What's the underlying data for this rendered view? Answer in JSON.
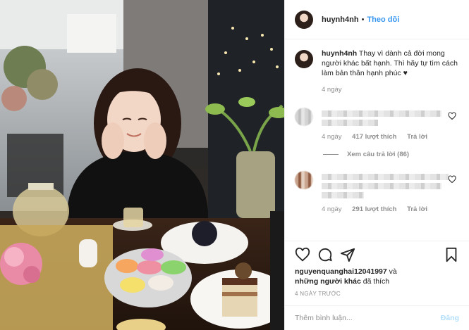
{
  "header": {
    "username": "huynh4nh",
    "separator": "•",
    "follow_label": "Theo dõi"
  },
  "caption": {
    "username": "huynh4nh",
    "text": "Thay vì dành cả đời mong người khác bất hạnh. Thì hãy tự tìm cách làm bản thân hạnh phúc ♥",
    "time": "4 ngày"
  },
  "comments": [
    {
      "time": "4 ngày",
      "likes": "417 lượt thích",
      "reply_label": "Trả lời",
      "view_replies": "Xem câu trả lời (86)"
    },
    {
      "time": "4 ngày",
      "likes": "291 lượt thích",
      "reply_label": "Trả lời"
    }
  ],
  "likes": {
    "user": "nguyenquanghai12041997",
    "connector": "và",
    "others": "những người khác",
    "suffix": "đã thích"
  },
  "posted_ago": "4 NGÀY TRƯỚC",
  "add_comment": {
    "placeholder": "Thêm bình luận...",
    "post_label": "Đăng"
  },
  "icons": [
    "heart-icon",
    "comment-icon",
    "share-icon",
    "bookmark-icon"
  ],
  "colors": {
    "link": "#3897f0",
    "muted": "#8e8e8e",
    "post_disabled": "#b2dffc"
  }
}
